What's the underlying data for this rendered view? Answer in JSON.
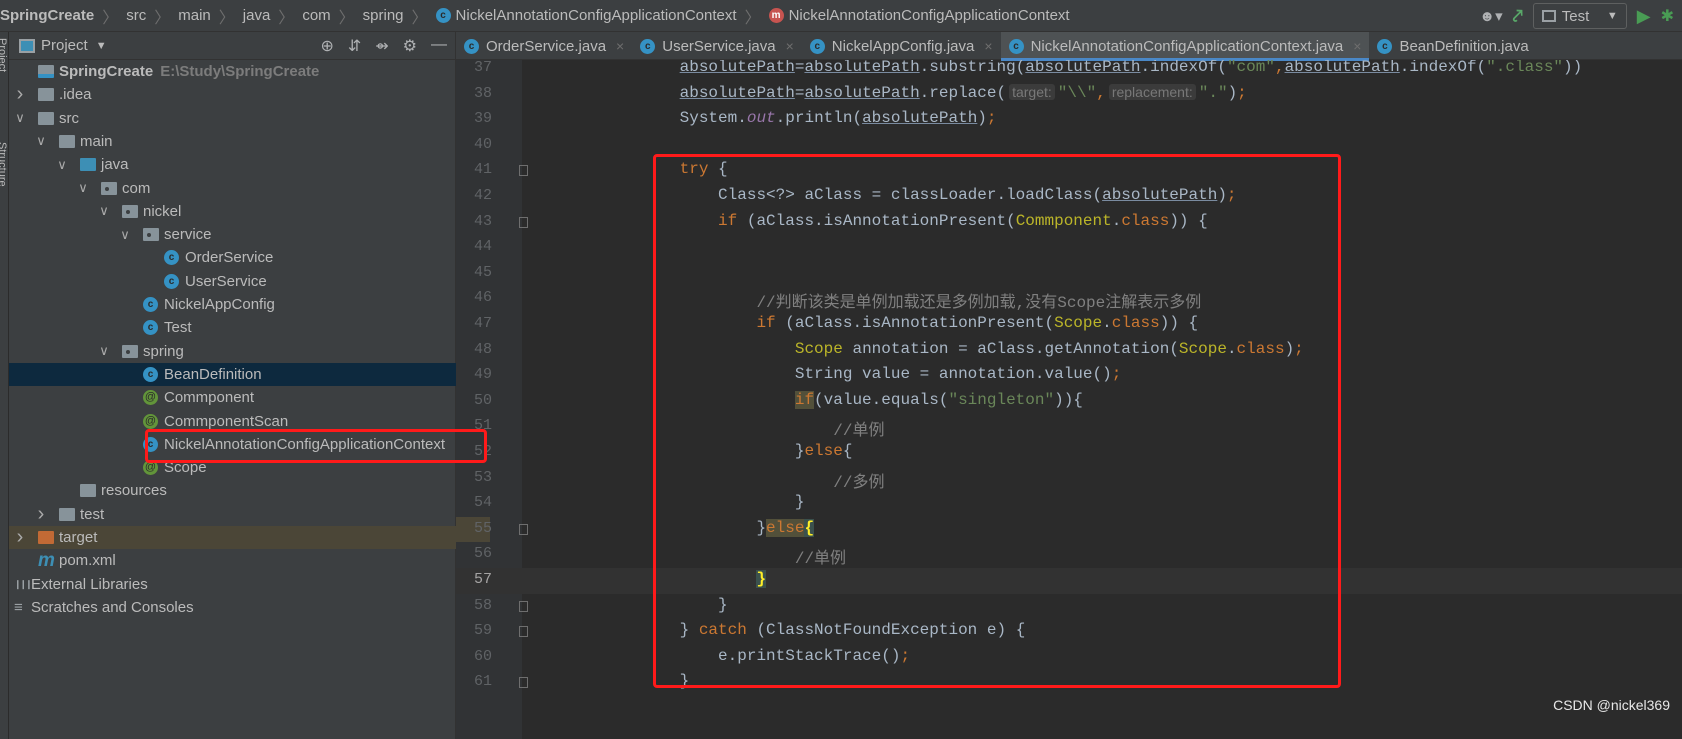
{
  "breadcrumb": [
    "SpringCreate",
    "src",
    "main",
    "java",
    "com",
    "spring",
    "NickelAnnotationConfigApplicationContext",
    "NickelAnnotationConfigApplicationContext"
  ],
  "toolbar": {
    "run_config": "Test",
    "icons": [
      "user-icon",
      "hammer-icon",
      "run-icon",
      "debug-icon"
    ]
  },
  "strip": {
    "project": "Project",
    "structure": "Structure"
  },
  "panel": {
    "title": "Project",
    "icons": [
      "locate-icon",
      "expand-all-icon",
      "collapse-all-icon",
      "gear-icon",
      "minimize-icon"
    ]
  },
  "tree": [
    {
      "label": "SpringCreate",
      "hint": "E:\\Study\\SpringCreate",
      "depth": 0,
      "icon": "module",
      "arrow": "none",
      "bold": true
    },
    {
      "label": ".idea",
      "depth": 0,
      "icon": "folder",
      "arrow": "collapsed"
    },
    {
      "label": "src",
      "depth": 0,
      "icon": "folder",
      "arrow": "expanded"
    },
    {
      "label": "main",
      "depth": 1,
      "icon": "folder",
      "arrow": "expanded"
    },
    {
      "label": "java",
      "depth": 2,
      "icon": "src-folder",
      "arrow": "expanded"
    },
    {
      "label": "com",
      "depth": 3,
      "icon": "package",
      "arrow": "expanded"
    },
    {
      "label": "nickel",
      "depth": 4,
      "icon": "package",
      "arrow": "expanded"
    },
    {
      "label": "service",
      "depth": 5,
      "icon": "package",
      "arrow": "expanded"
    },
    {
      "label": "OrderService",
      "depth": 6,
      "icon": "class"
    },
    {
      "label": "UserService",
      "depth": 6,
      "icon": "class"
    },
    {
      "label": "NickelAppConfig",
      "depth": 5,
      "icon": "class"
    },
    {
      "label": "Test",
      "depth": 5,
      "icon": "class"
    },
    {
      "label": "spring",
      "depth": 4,
      "icon": "package",
      "arrow": "expanded"
    },
    {
      "label": "BeanDefinition",
      "depth": 5,
      "icon": "class",
      "selected": true
    },
    {
      "label": "Commponent",
      "depth": 5,
      "icon": "annotation"
    },
    {
      "label": "CommponentScan",
      "depth": 5,
      "icon": "annotation"
    },
    {
      "label": "NickelAnnotationConfigApplicationContext",
      "depth": 5,
      "icon": "class"
    },
    {
      "label": "Scope",
      "depth": 5,
      "icon": "annotation"
    },
    {
      "label": "resources",
      "depth": 2,
      "icon": "folder"
    },
    {
      "label": "test",
      "depth": 1,
      "icon": "folder",
      "arrow": "collapsed"
    },
    {
      "label": "target",
      "depth": 0,
      "icon": "orange-folder",
      "arrow": "collapsed",
      "excluded": true
    },
    {
      "label": "pom.xml",
      "depth": 0,
      "icon": "maven"
    },
    {
      "label": "External Libraries",
      "depth": -1,
      "icon": "libraries"
    },
    {
      "label": "Scratches and Consoles",
      "depth": -1,
      "icon": "scratches"
    }
  ],
  "tabs": [
    {
      "label": "OrderService.java"
    },
    {
      "label": "UserService.java"
    },
    {
      "label": "NickelAppConfig.java"
    },
    {
      "label": "NickelAnnotationConfigApplicationContext.java",
      "active": true
    },
    {
      "label": "BeanDefinition.java"
    }
  ],
  "current_line": 57,
  "code": [
    {
      "n": "37",
      "i": 16,
      "t": [
        [
          "u",
          "absolutePath"
        ],
        [
          "d",
          "="
        ],
        [
          "u",
          "absolutePath"
        ],
        [
          "d",
          ".substring("
        ],
        [
          "u",
          "absolutePath"
        ],
        [
          "d",
          ".indexOf("
        ],
        [
          "s",
          "\"com\""
        ],
        [
          "k",
          ","
        ],
        [
          "u",
          "absolutePath"
        ],
        [
          "d",
          ".indexOf("
        ],
        [
          "s",
          "\".class\""
        ],
        [
          "d",
          "))"
        ]
      ]
    },
    {
      "n": "38",
      "i": 16,
      "t": [
        [
          "u",
          "absolutePath"
        ],
        [
          "d",
          "="
        ],
        [
          "u",
          "absolutePath"
        ],
        [
          "d",
          ".replace("
        ],
        [
          "h",
          "target:"
        ],
        [
          "s",
          "\"\\\\\""
        ],
        [
          "k",
          ","
        ],
        [
          "h",
          "replacement:"
        ],
        [
          "s",
          "\".\""
        ],
        [
          "d",
          ")"
        ],
        [
          "k",
          ";"
        ]
      ]
    },
    {
      "n": "39",
      "i": 16,
      "t": [
        [
          "d",
          "System."
        ],
        [
          "f",
          "out"
        ],
        [
          "d",
          ".println("
        ],
        [
          "u",
          "absolutePath"
        ],
        [
          "d",
          ")"
        ],
        [
          "k",
          ";"
        ]
      ]
    },
    {
      "n": "40",
      "i": 0,
      "t": []
    },
    {
      "n": "41",
      "i": 16,
      "t": [
        [
          "k",
          "try"
        ],
        [
          "d",
          " {"
        ]
      ]
    },
    {
      "n": "42",
      "i": 20,
      "t": [
        [
          "d",
          "Class<?> aClass = classLoader.loadClass("
        ],
        [
          "u",
          "absolutePath"
        ],
        [
          "d",
          ")"
        ],
        [
          "k",
          ";"
        ]
      ]
    },
    {
      "n": "43",
      "i": 20,
      "t": [
        [
          "k",
          "if"
        ],
        [
          "d",
          " (aClass.isAnnotationPresent("
        ],
        [
          "a",
          "Commponent"
        ],
        [
          "d",
          "."
        ],
        [
          "k",
          "class"
        ],
        [
          "d",
          ")) {"
        ]
      ]
    },
    {
      "n": "44",
      "i": 0,
      "t": []
    },
    {
      "n": "45",
      "i": 0,
      "t": []
    },
    {
      "n": "46",
      "i": 24,
      "t": [
        [
          "c",
          "//判断该类是单例加载还是多例加载,没有Scope注解表示多例"
        ]
      ]
    },
    {
      "n": "47",
      "i": 24,
      "t": [
        [
          "k",
          "if"
        ],
        [
          "d",
          " (aClass.isAnnotationPresent("
        ],
        [
          "a",
          "Scope"
        ],
        [
          "d",
          "."
        ],
        [
          "k",
          "class"
        ],
        [
          "d",
          ")) {"
        ]
      ]
    },
    {
      "n": "48",
      "i": 28,
      "t": [
        [
          "a",
          "Scope"
        ],
        [
          "d",
          " annotation = aClass.getAnnotation("
        ],
        [
          "a",
          "Scope"
        ],
        [
          "d",
          "."
        ],
        [
          "k",
          "class"
        ],
        [
          "d",
          ")"
        ],
        [
          "k",
          ";"
        ]
      ]
    },
    {
      "n": "49",
      "i": 28,
      "t": [
        [
          "d",
          "String value = annotation.value()"
        ],
        [
          "k",
          ";"
        ]
      ]
    },
    {
      "n": "50",
      "i": 28,
      "t": [
        [
          "kh",
          "if"
        ],
        [
          "d",
          "(value.equals("
        ],
        [
          "s",
          "\"singleton\""
        ],
        [
          "d",
          "))"
        ],
        [
          "d",
          "{"
        ]
      ]
    },
    {
      "n": "51",
      "i": 32,
      "t": [
        [
          "c",
          "//单例"
        ]
      ]
    },
    {
      "n": "52",
      "i": 28,
      "t": [
        [
          "d",
          "}"
        ],
        [
          "k",
          "else"
        ],
        [
          "d",
          "{"
        ]
      ]
    },
    {
      "n": "53",
      "i": 32,
      "t": [
        [
          "c",
          "//多例"
        ]
      ]
    },
    {
      "n": "54",
      "i": 28,
      "t": [
        [
          "d",
          "}"
        ]
      ]
    },
    {
      "n": "55",
      "i": 24,
      "t": [
        [
          "d",
          "}"
        ],
        [
          "kh",
          "else"
        ],
        [
          "bh",
          "{"
        ]
      ]
    },
    {
      "n": "56",
      "i": 28,
      "t": [
        [
          "c",
          "//单例"
        ]
      ]
    },
    {
      "n": "57",
      "i": 24,
      "t": [
        [
          "bh",
          "}"
        ]
      ]
    },
    {
      "n": "58",
      "i": 20,
      "t": [
        [
          "d",
          "}"
        ]
      ]
    },
    {
      "n": "59",
      "i": 16,
      "t": [
        [
          "d",
          "} "
        ],
        [
          "k",
          "catch"
        ],
        [
          "d",
          " (ClassNotFoundException e) {"
        ]
      ]
    },
    {
      "n": "60",
      "i": 20,
      "t": [
        [
          "d",
          "e.printStackTrace()"
        ],
        [
          "k",
          ";"
        ]
      ]
    },
    {
      "n": "61",
      "i": 16,
      "t": [
        [
          "d",
          "}"
        ]
      ]
    }
  ],
  "folds": [
    "41",
    "43",
    "55",
    "58",
    "59",
    "61"
  ],
  "annotations": {
    "highlight_color": "#ff1a1a",
    "boxes": [
      "code-try-block",
      "tree-item-NickelAnnotationConfigApplicationContext"
    ]
  },
  "watermark": "CSDN @nickel369",
  "colors": {
    "keyword": "#cc7832",
    "string": "#6a8759",
    "comment": "#808080",
    "annotation": "#bbb529",
    "text": "#a9b7c6",
    "accent": "#4a88c7"
  }
}
